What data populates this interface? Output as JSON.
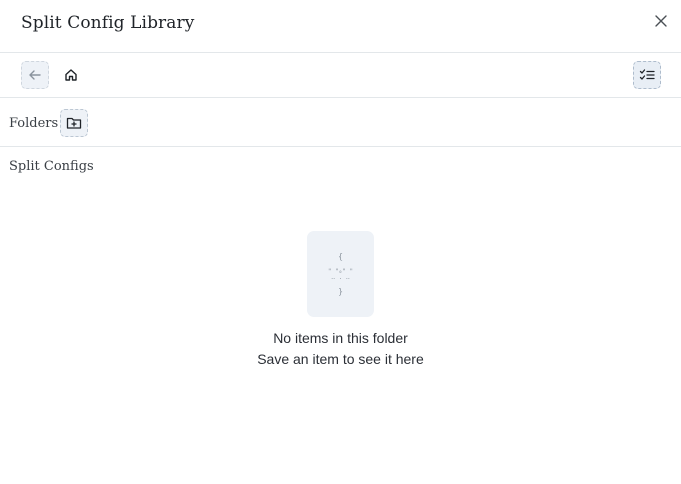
{
  "header": {
    "title": "Split Config Library",
    "close_icon": "close-icon"
  },
  "toolbar": {
    "back_icon": "arrow-left-icon",
    "home_icon": "home-icon",
    "select_icon": "checklist-icon"
  },
  "folders": {
    "label": "Folders",
    "new_folder_icon": "folder-plus-icon"
  },
  "split_configs": {
    "label": "Split Configs"
  },
  "empty_state": {
    "icon": "empty-file-icon",
    "title": "No items in this folder",
    "subtitle": "Save an item to see it here"
  },
  "colors": {
    "border": "#e3e7ea",
    "button_bg": "#eef2f7",
    "icon": "#2b2f36"
  }
}
